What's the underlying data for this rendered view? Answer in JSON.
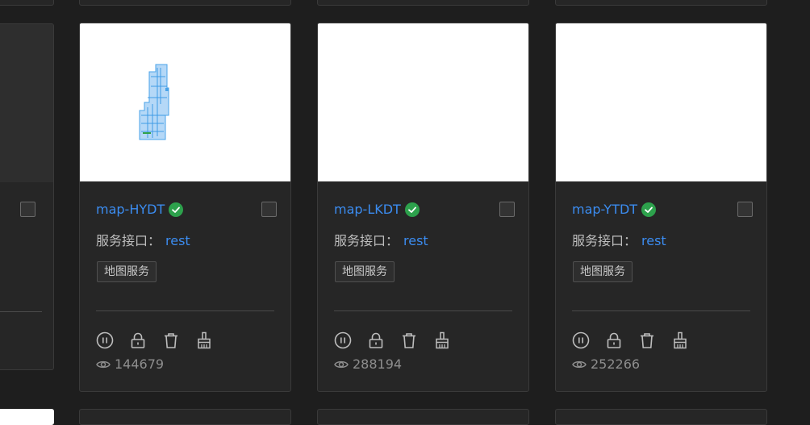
{
  "cards": [
    {
      "name": "map-HYDT",
      "interface_label": "服务接口：",
      "interface_value": "rest",
      "tag": "地图服务",
      "views": "144679",
      "has_preview_image": true
    },
    {
      "name": "map-LKDT",
      "interface_label": "服务接口：",
      "interface_value": "rest",
      "tag": "地图服务",
      "views": "288194",
      "has_preview_image": false
    },
    {
      "name": "map-YTDT",
      "interface_label": "服务接口：",
      "interface_value": "rest",
      "tag": "地图服务",
      "views": "252266",
      "has_preview_image": false
    }
  ],
  "actions": [
    "pause-icon",
    "lock-icon",
    "trash-icon",
    "brush-icon"
  ],
  "colors": {
    "background": "#1e1e1e",
    "card": "#262626",
    "link": "#3b8cf0",
    "verified": "#2da14c",
    "muted": "#8e8e8e"
  }
}
